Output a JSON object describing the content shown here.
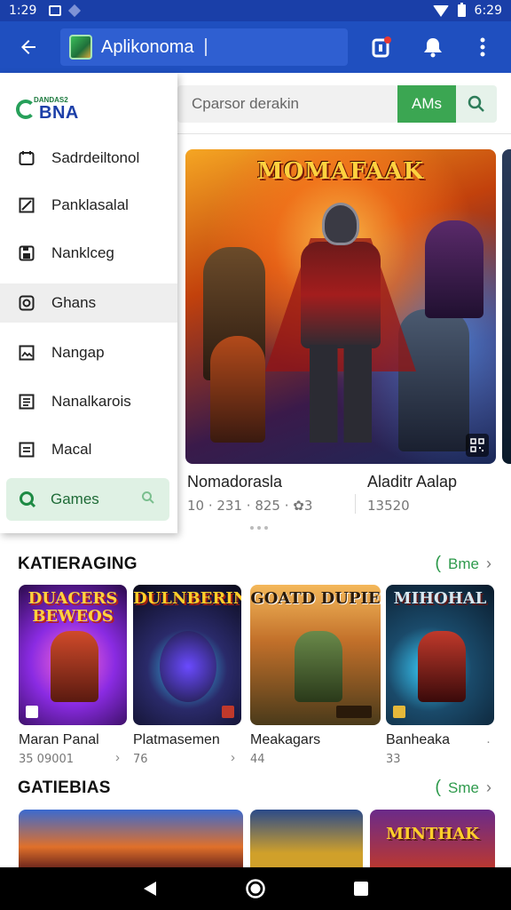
{
  "status_bar": {
    "time": "1:29",
    "battery_time": "6:29"
  },
  "app_bar": {
    "search_text": "Aplikonoma"
  },
  "main": {
    "search_placeholder": "Cparsor derakin",
    "search_button_label": "AMs",
    "featured": [
      {
        "art_title": "MOMAFAAK",
        "name": "Nomadorasla",
        "meta": "10 · 231 · 825 · ✿3"
      },
      {
        "name": "Aladitr Aalap",
        "meta": "13520"
      }
    ]
  },
  "drawer": {
    "logo_small": "DANDAS2",
    "logo_text": "BNA",
    "items": [
      {
        "label": "Sadrdeiltonol",
        "icon": "calendar-icon"
      },
      {
        "label": "Panklasalal",
        "icon": "edit-icon"
      },
      {
        "label": "Nanklceg",
        "icon": "save-icon"
      },
      {
        "label": "Ghans",
        "icon": "link-icon",
        "active": true
      },
      {
        "label": "Nangap",
        "icon": "image-icon"
      },
      {
        "label": "Nanalkarois",
        "icon": "document-icon"
      },
      {
        "label": "Macal",
        "icon": "note-icon"
      }
    ],
    "games_label": "Games"
  },
  "sections": [
    {
      "title": "KATIERAGING",
      "see_all": "Bme",
      "games": [
        {
          "art_title": "DUACERS BEWEOS",
          "name": "Maran Panal",
          "meta": "35 09001"
        },
        {
          "art_title": "DULNBERING",
          "name": "Platmasemen",
          "meta": "76"
        },
        {
          "art_title": "GOATD DUPIE",
          "name": "Meakagars",
          "meta": "44"
        },
        {
          "art_title": "MIHOHAL",
          "name": "Banheaka",
          "meta": "33"
        }
      ]
    },
    {
      "title": "GATIEBIAS",
      "see_all": "Sme",
      "games": [
        {
          "art_title": ""
        },
        {
          "art_title": ""
        },
        {
          "art_title": "MINTHAK"
        }
      ]
    }
  ],
  "colors": {
    "app_bar": "#1f4fbf",
    "status_bar": "#1a3fa8",
    "accent_green": "#3ba652",
    "drawer_active": "#eeeeee"
  }
}
